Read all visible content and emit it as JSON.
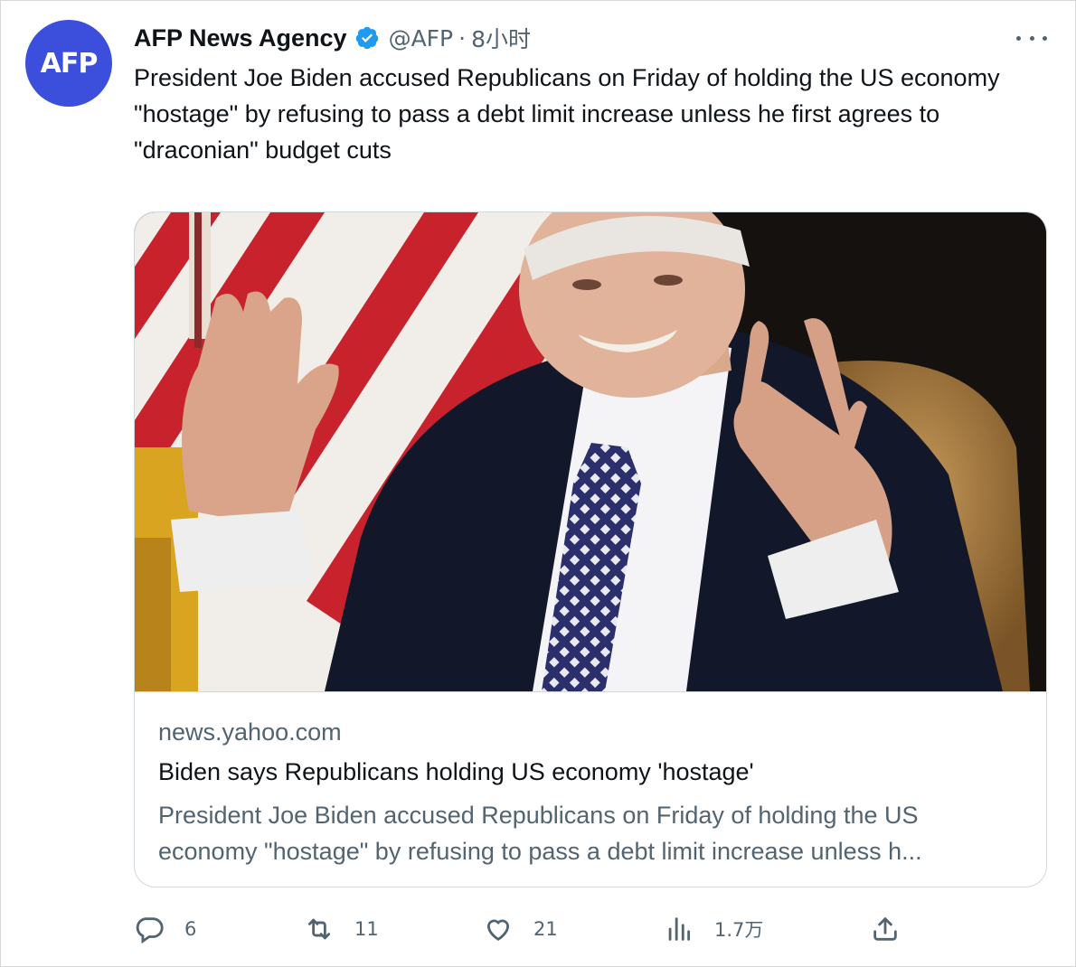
{
  "tweet": {
    "avatar_text": "AFP",
    "author_name": "AFP News Agency",
    "handle": "@AFP",
    "separator": "·",
    "time": "8小时",
    "text": "President Joe Biden accused Republicans on Friday of holding the US economy \"hostage\" by refusing to pass a debt limit increase unless he first agrees to \"draconian\" budget cuts"
  },
  "card": {
    "image_alt": "Joe Biden gesturing with raised hands in front of a US flag",
    "domain": "news.yahoo.com",
    "title": "Biden says Republicans holding US economy 'hostage'",
    "description_line1": "President Joe Biden accused Republicans on Friday of holding the US",
    "description_line2": "economy \"hostage\" by refusing to pass a debt limit increase unless h..."
  },
  "actions": {
    "reply_count": "6",
    "retweet_count": "11",
    "like_count": "21",
    "views_count": "1.7万"
  },
  "colors": {
    "accent": "#1d9bf0",
    "avatar_bg": "#3b4fdc",
    "muted_text": "#536471",
    "border": "#cfd9de"
  },
  "icons": [
    "more-icon",
    "verified-badge-icon",
    "reply-icon",
    "retweet-icon",
    "like-icon",
    "views-icon",
    "share-icon"
  ]
}
